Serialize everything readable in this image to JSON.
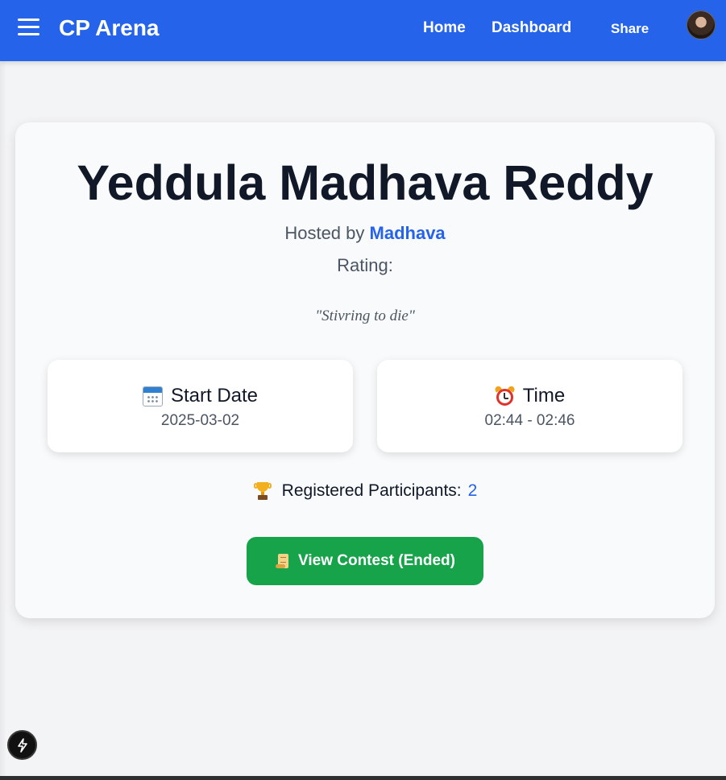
{
  "navbar": {
    "brand": "CP Arena",
    "links": [
      {
        "label": "Home"
      },
      {
        "label": "Dashboard"
      },
      {
        "label": "Share"
      }
    ],
    "accent_color": "#2563eb"
  },
  "contest": {
    "title": "Yeddula Madhava Reddy",
    "hosted_prefix": "Hosted by",
    "host_name": "Madhava",
    "rating_label": "Rating:",
    "quote": "\"Stivring to die\"",
    "start_date": {
      "icon": "calendar-icon",
      "label": "Start Date",
      "value": "2025-03-02"
    },
    "time": {
      "icon": "alarm-clock-icon",
      "label": "Time",
      "value": "02:44 - 02:46"
    },
    "participants": {
      "icon": "trophy-icon",
      "label": "Registered Participants:",
      "count": "2"
    },
    "view_button": {
      "icon": "scroll-icon",
      "label": "View Contest (Ended)",
      "color": "#16a34a"
    }
  }
}
